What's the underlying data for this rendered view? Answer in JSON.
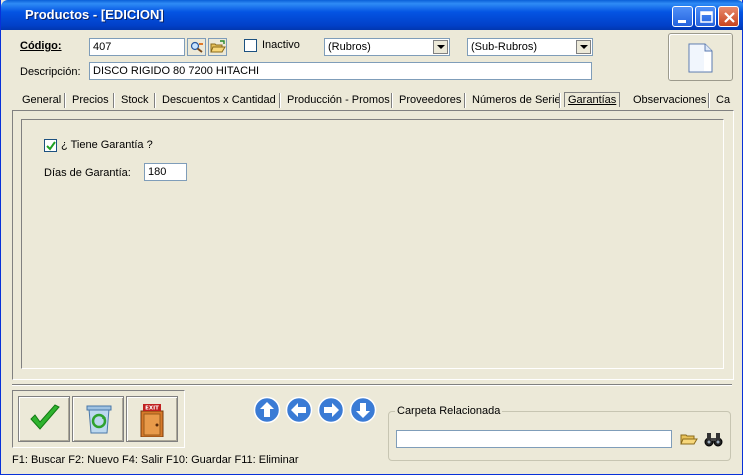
{
  "window": {
    "title": "Productos - [EDICION]",
    "controls": [
      "minimize-icon",
      "maximize-icon",
      "close-icon"
    ]
  },
  "header": {
    "codigo_label": "Código:",
    "codigo_value": "407",
    "inactivo_label": "Inactivo",
    "inactivo_checked": false,
    "rubros_value": "(Rubros)",
    "subrubros_value": "(Sub-Rubros)",
    "descripcion_label": "Descripción:",
    "descripcion_value": "DISCO RIGIDO 80 7200  HITACHI"
  },
  "tabs": [
    {
      "label": "General",
      "active": false
    },
    {
      "label": "Precios",
      "active": false
    },
    {
      "label": "Stock",
      "active": false
    },
    {
      "label": "Descuentos x Cantidad",
      "active": false
    },
    {
      "label": "Producción - Promos",
      "active": false
    },
    {
      "label": "Proveedores",
      "active": false
    },
    {
      "label": "Números de Serie",
      "active": false
    },
    {
      "label": "Garantías",
      "active": true
    },
    {
      "label": "Observaciones",
      "active": false
    },
    {
      "label": "Ca",
      "active": false
    }
  ],
  "garantias": {
    "tiene_garantia_label": "¿ Tiene Garantía ?",
    "tiene_garantia_checked": true,
    "dias_label": "Días de Garantía:",
    "dias_value": "180"
  },
  "actions": {
    "accept": "checkmark-icon",
    "recycle": "recycle-icon",
    "exit": "exit-door-icon",
    "exit_sign": "EXIT"
  },
  "navigation": [
    "arrow-up-icon",
    "arrow-left-icon",
    "arrow-right-icon",
    "arrow-down-icon"
  ],
  "carpeta": {
    "label": "Carpeta Relacionada",
    "value": ""
  },
  "hotkeys": "F1: Buscar  F2: Nuevo  F4: Salir  F10: Guardar  F11: Eliminar",
  "colors": {
    "titlebar": "#0454e3",
    "window_bg": "#ece9d8",
    "field_border": "#7f9db9",
    "check_green": "#2fb32f",
    "nav_blue": "#3a7bd5"
  }
}
